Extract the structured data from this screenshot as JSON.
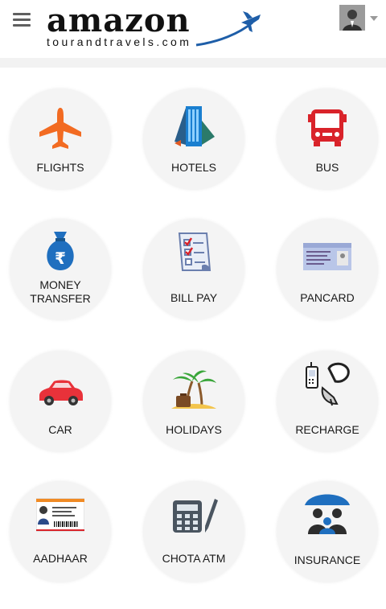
{
  "header": {
    "logo_word": "amazon",
    "logo_sub": "tourandtravels.com",
    "menu_icon": "hamburger-menu-icon",
    "avatar_icon": "user-avatar-icon",
    "caret_icon": "chevron-down-icon"
  },
  "colors": {
    "tile_bg": "#f4f4f4",
    "plane_orange": "#f26b22",
    "logo_plane_blue": "#1e5ea8",
    "bus_red": "#d9232a",
    "car_red": "#e8323a",
    "bag_blue": "#1f6fbf"
  },
  "services": [
    {
      "label": "FLIGHTS",
      "icon": "airplane-icon"
    },
    {
      "label": "HOTELS",
      "icon": "hotel-building-icon"
    },
    {
      "label": "BUS",
      "icon": "bus-icon"
    },
    {
      "label": "MONEY\nTRANSFER",
      "icon": "money-bag-rupee-icon"
    },
    {
      "label": "BILL PAY",
      "icon": "bill-checklist-icon"
    },
    {
      "label": "PANCARD",
      "icon": "pan-card-icon"
    },
    {
      "label": "CAR",
      "icon": "car-icon"
    },
    {
      "label": "HOLIDAYS",
      "icon": "palm-tree-suitcase-icon"
    },
    {
      "label": "RECHARGE",
      "icon": "phone-dish-antenna-icon"
    },
    {
      "label": "AADHAAR",
      "icon": "aadhaar-card-icon"
    },
    {
      "label": "CHOTA ATM",
      "icon": "calculator-pen-icon"
    },
    {
      "label": "INSURANCE",
      "icon": "umbrella-family-icon"
    }
  ]
}
